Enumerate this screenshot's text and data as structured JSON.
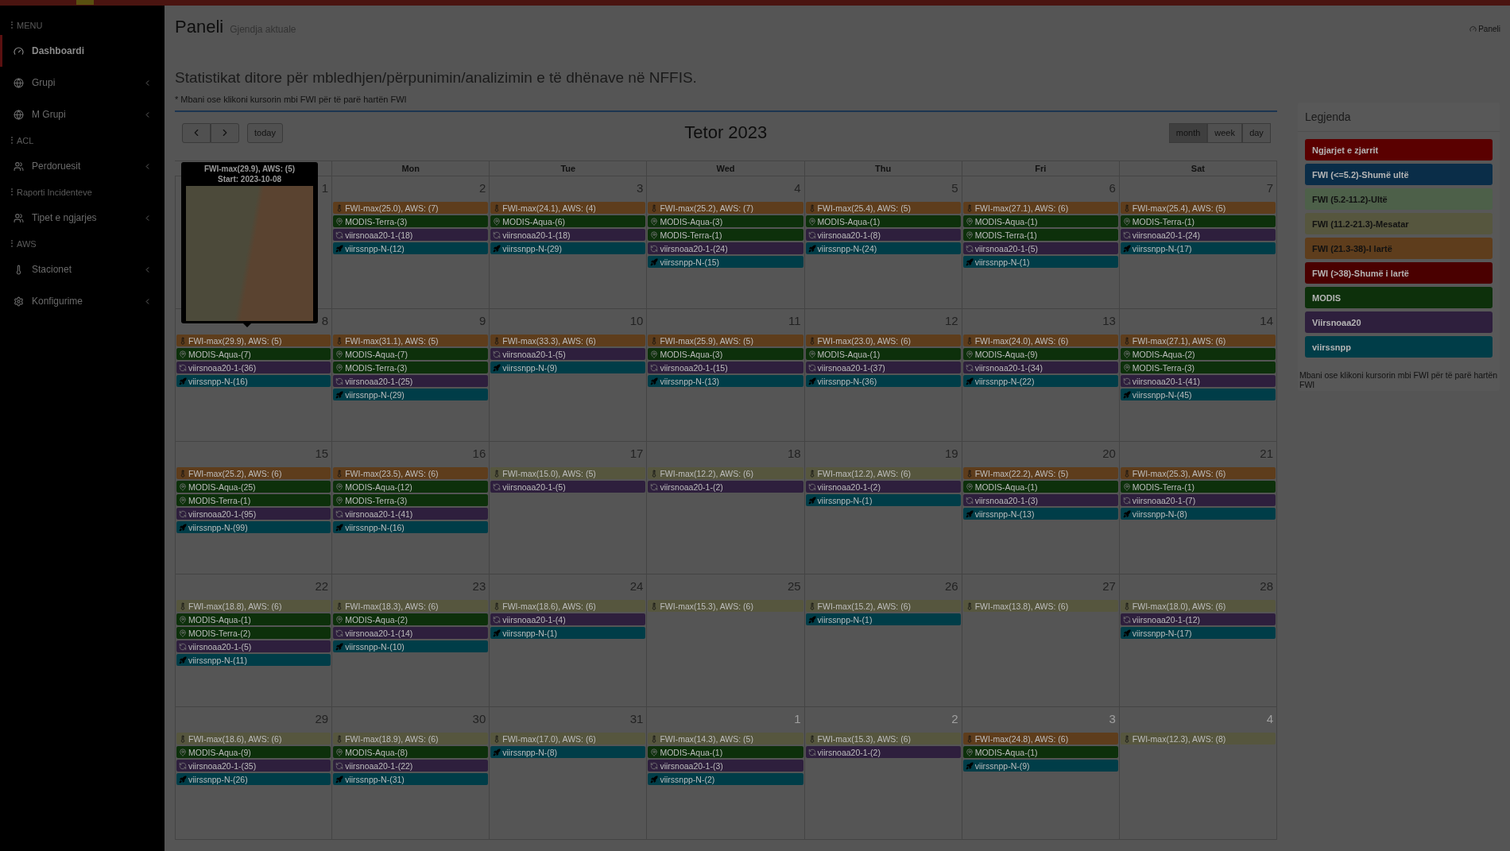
{
  "sidebar": {
    "sections": [
      {
        "header": "MENU",
        "items": [
          {
            "label": "Dashboardi",
            "selected": true,
            "expandable": false
          },
          {
            "label": "Grupi",
            "selected": false,
            "expandable": true
          },
          {
            "label": "M Grupi",
            "selected": false,
            "expandable": true
          }
        ]
      },
      {
        "header": "ACL",
        "items": [
          {
            "label": "Perdoruesit",
            "selected": false,
            "expandable": true
          }
        ]
      },
      {
        "header": "Raporti Incidenteve",
        "items": [
          {
            "label": "Tipet e ngjarjes",
            "selected": false,
            "expandable": true
          }
        ]
      },
      {
        "header": "AWS",
        "items": [
          {
            "label": "Stacionet",
            "selected": false,
            "expandable": true
          },
          {
            "label": "Konfigurime",
            "selected": false,
            "expandable": true
          }
        ]
      }
    ]
  },
  "header": {
    "title": "Paneli",
    "subtitle": "Gjendja aktuale",
    "breadcrumb": "Paneli"
  },
  "intro": {
    "heading": "Statistikat ditore për mbledhjen/përpunimin/analizimin e të dhënave në NFFIS.",
    "note": "* Mbani ose klikoni kursorin mbi FWI për të parë hartën FWI"
  },
  "calendar": {
    "today": "today",
    "title": "Tetor 2023",
    "views": [
      {
        "label": "month",
        "selected": true
      },
      {
        "label": "week",
        "selected": false
      },
      {
        "label": "day",
        "selected": false
      }
    ],
    "weekdays": [
      "Mon",
      "Tue",
      "Wed",
      "Thu",
      "Fri",
      "Sat"
    ],
    "tooltip": {
      "title": "FWI-max(29.9), AWS: (5)",
      "start": "Start: 2023-10-08"
    },
    "weeks": [
      {
        "days": [
          {
            "number": "1",
            "other_month": false
          },
          {
            "number": "2",
            "other_month": false,
            "events": [
              {
                "kind": "fwi",
                "label": "FWI-max(25.0), AWS: (7)",
                "color": "#5e3d1c"
              },
              {
                "kind": "modis",
                "label": "MODIS-Terra-(3)",
                "color": "#0d300b"
              },
              {
                "kind": "noaa",
                "label": "viirsnoaa20-1-(18)",
                "color": "#2e1f3d"
              },
              {
                "kind": "snpp",
                "label": "viirssnpp-N-(12)",
                "color": "#003d48"
              }
            ]
          },
          {
            "number": "3",
            "other_month": false,
            "events": [
              {
                "kind": "fwi",
                "label": "FWI-max(24.1), AWS: (4)",
                "color": "#5e3d1c"
              },
              {
                "kind": "modis",
                "label": "MODIS-Aqua-(6)",
                "color": "#0d300b"
              },
              {
                "kind": "noaa",
                "label": "viirsnoaa20-1-(18)",
                "color": "#2e1f3d"
              },
              {
                "kind": "snpp",
                "label": "viirssnpp-N-(29)",
                "color": "#003d48"
              }
            ]
          },
          {
            "number": "4",
            "other_month": false,
            "events": [
              {
                "kind": "fwi",
                "label": "FWI-max(25.2), AWS: (7)",
                "color": "#5e3d1c"
              },
              {
                "kind": "modis",
                "label": "MODIS-Aqua-(3)",
                "color": "#0d300b"
              },
              {
                "kind": "modis",
                "label": "MODIS-Terra-(1)",
                "color": "#0d300b"
              },
              {
                "kind": "noaa",
                "label": "viirsnoaa20-1-(24)",
                "color": "#2e1f3d"
              },
              {
                "kind": "snpp",
                "label": "viirssnpp-N-(15)",
                "color": "#003d48"
              }
            ]
          },
          {
            "number": "5",
            "other_month": false,
            "events": [
              {
                "kind": "fwi",
                "label": "FWI-max(25.4), AWS: (5)",
                "color": "#5e3d1c"
              },
              {
                "kind": "modis",
                "label": "MODIS-Aqua-(1)",
                "color": "#0d300b"
              },
              {
                "kind": "noaa",
                "label": "viirsnoaa20-1-(8)",
                "color": "#2e1f3d"
              },
              {
                "kind": "snpp",
                "label": "viirssnpp-N-(24)",
                "color": "#003d48"
              }
            ]
          },
          {
            "number": "6",
            "other_month": false,
            "events": [
              {
                "kind": "fwi",
                "label": "FWI-max(27.1), AWS: (6)",
                "color": "#5e3d1c"
              },
              {
                "kind": "modis",
                "label": "MODIS-Aqua-(1)",
                "color": "#0d300b"
              },
              {
                "kind": "modis",
                "label": "MODIS-Terra-(1)",
                "color": "#0d300b"
              },
              {
                "kind": "noaa",
                "label": "viirsnoaa20-1-(5)",
                "color": "#2e1f3d"
              },
              {
                "kind": "snpp",
                "label": "viirssnpp-N-(1)",
                "color": "#003d48"
              }
            ]
          },
          {
            "number": "7",
            "other_month": false,
            "events": [
              {
                "kind": "fwi",
                "label": "FWI-max(25.4), AWS: (5)",
                "color": "#5e3d1c"
              },
              {
                "kind": "modis",
                "label": "MODIS-Terra-(1)",
                "color": "#0d300b"
              },
              {
                "kind": "noaa",
                "label": "viirsnoaa20-1-(24)",
                "color": "#2e1f3d"
              },
              {
                "kind": "snpp",
                "label": "viirssnpp-N-(17)",
                "color": "#003d48"
              }
            ]
          }
        ]
      },
      {
        "days": [
          {
            "number": "8",
            "other_month": false,
            "events": [
              {
                "kind": "fwi",
                "label": "FWI-max(29.9), AWS: (5)",
                "color": "#5e3d1c"
              },
              {
                "kind": "modis",
                "label": "MODIS-Aqua-(7)",
                "color": "#0d300b"
              },
              {
                "kind": "noaa",
                "label": "viirsnoaa20-1-(36)",
                "color": "#2e1f3d"
              },
              {
                "kind": "snpp",
                "label": "viirssnpp-N-(16)",
                "color": "#003d48"
              }
            ]
          },
          {
            "number": "9",
            "other_month": false,
            "events": [
              {
                "kind": "fwi",
                "label": "FWI-max(31.1), AWS: (5)",
                "color": "#5e3d1c"
              },
              {
                "kind": "modis",
                "label": "MODIS-Aqua-(7)",
                "color": "#0d300b"
              },
              {
                "kind": "modis",
                "label": "MODIS-Terra-(3)",
                "color": "#0d300b"
              },
              {
                "kind": "noaa",
                "label": "viirsnoaa20-1-(25)",
                "color": "#2e1f3d"
              },
              {
                "kind": "snpp",
                "label": "viirssnpp-N-(29)",
                "color": "#003d48"
              }
            ]
          },
          {
            "number": "10",
            "other_month": false,
            "events": [
              {
                "kind": "fwi",
                "label": "FWI-max(33.3), AWS: (6)",
                "color": "#5e3d1c"
              },
              {
                "kind": "noaa",
                "label": "viirsnoaa20-1-(5)",
                "color": "#2e1f3d"
              },
              {
                "kind": "snpp",
                "label": "viirssnpp-N-(9)",
                "color": "#003d48"
              }
            ]
          },
          {
            "number": "11",
            "other_month": false,
            "events": [
              {
                "kind": "fwi",
                "label": "FWI-max(25.9), AWS: (5)",
                "color": "#5e3d1c"
              },
              {
                "kind": "modis",
                "label": "MODIS-Aqua-(3)",
                "color": "#0d300b"
              },
              {
                "kind": "noaa",
                "label": "viirsnoaa20-1-(15)",
                "color": "#2e1f3d"
              },
              {
                "kind": "snpp",
                "label": "viirssnpp-N-(13)",
                "color": "#003d48"
              }
            ]
          },
          {
            "number": "12",
            "other_month": false,
            "events": [
              {
                "kind": "fwi",
                "label": "FWI-max(23.0), AWS: (6)",
                "color": "#5e3d1c"
              },
              {
                "kind": "modis",
                "label": "MODIS-Aqua-(1)",
                "color": "#0d300b"
              },
              {
                "kind": "noaa",
                "label": "viirsnoaa20-1-(37)",
                "color": "#2e1f3d"
              },
              {
                "kind": "snpp",
                "label": "viirssnpp-N-(36)",
                "color": "#003d48"
              }
            ]
          },
          {
            "number": "13",
            "other_month": false,
            "events": [
              {
                "kind": "fwi",
                "label": "FWI-max(24.0), AWS: (6)",
                "color": "#5e3d1c"
              },
              {
                "kind": "modis",
                "label": "MODIS-Aqua-(9)",
                "color": "#0d300b"
              },
              {
                "kind": "noaa",
                "label": "viirsnoaa20-1-(34)",
                "color": "#2e1f3d"
              },
              {
                "kind": "snpp",
                "label": "viirssnpp-N-(22)",
                "color": "#003d48"
              }
            ]
          },
          {
            "number": "14",
            "other_month": false,
            "events": [
              {
                "kind": "fwi",
                "label": "FWI-max(27.1), AWS: (6)",
                "color": "#5e3d1c"
              },
              {
                "kind": "modis",
                "label": "MODIS-Aqua-(2)",
                "color": "#0d300b"
              },
              {
                "kind": "modis",
                "label": "MODIS-Terra-(3)",
                "color": "#0d300b"
              },
              {
                "kind": "noaa",
                "label": "viirsnoaa20-1-(41)",
                "color": "#2e1f3d"
              },
              {
                "kind": "snpp",
                "label": "viirssnpp-N-(45)",
                "color": "#003d48"
              }
            ]
          }
        ]
      },
      {
        "days": [
          {
            "number": "15",
            "other_month": false,
            "events": [
              {
                "kind": "fwi",
                "label": "FWI-max(25.2), AWS: (6)",
                "color": "#5e3d1c"
              },
              {
                "kind": "modis",
                "label": "MODIS-Aqua-(25)",
                "color": "#0d300b"
              },
              {
                "kind": "modis",
                "label": "MODIS-Terra-(1)",
                "color": "#0d300b"
              },
              {
                "kind": "noaa",
                "label": "viirsnoaa20-1-(95)",
                "color": "#2e1f3d"
              },
              {
                "kind": "snpp",
                "label": "viirssnpp-N-(99)",
                "color": "#003d48"
              }
            ]
          },
          {
            "number": "16",
            "other_month": false,
            "events": [
              {
                "kind": "fwi",
                "label": "FWI-max(23.5), AWS: (6)",
                "color": "#5e3d1c"
              },
              {
                "kind": "modis",
                "label": "MODIS-Aqua-(12)",
                "color": "#0d300b"
              },
              {
                "kind": "modis",
                "label": "MODIS-Terra-(3)",
                "color": "#0d300b"
              },
              {
                "kind": "noaa",
                "label": "viirsnoaa20-1-(41)",
                "color": "#2e1f3d"
              },
              {
                "kind": "snpp",
                "label": "viirssnpp-N-(16)",
                "color": "#003d48"
              }
            ]
          },
          {
            "number": "17",
            "other_month": false,
            "events": [
              {
                "kind": "fwi",
                "label": "FWI-max(15.0), AWS: (5)",
                "color": "#56563e"
              },
              {
                "kind": "noaa",
                "label": "viirsnoaa20-1-(5)",
                "color": "#2e1f3d"
              }
            ]
          },
          {
            "number": "18",
            "other_month": false,
            "events": [
              {
                "kind": "fwi",
                "label": "FWI-max(12.2), AWS: (6)",
                "color": "#56563e"
              },
              {
                "kind": "noaa",
                "label": "viirsnoaa20-1-(2)",
                "color": "#2e1f3d"
              }
            ]
          },
          {
            "number": "19",
            "other_month": false,
            "events": [
              {
                "kind": "fwi",
                "label": "FWI-max(12.2), AWS: (6)",
                "color": "#56563e"
              },
              {
                "kind": "noaa",
                "label": "viirsnoaa20-1-(2)",
                "color": "#2e1f3d"
              },
              {
                "kind": "snpp",
                "label": "viirssnpp-N-(1)",
                "color": "#003d48"
              }
            ]
          },
          {
            "number": "20",
            "other_month": false,
            "events": [
              {
                "kind": "fwi",
                "label": "FWI-max(22.2), AWS: (5)",
                "color": "#5e3d1c"
              },
              {
                "kind": "modis",
                "label": "MODIS-Aqua-(1)",
                "color": "#0d300b"
              },
              {
                "kind": "noaa",
                "label": "viirsnoaa20-1-(3)",
                "color": "#2e1f3d"
              },
              {
                "kind": "snpp",
                "label": "viirssnpp-N-(13)",
                "color": "#003d48"
              }
            ]
          },
          {
            "number": "21",
            "other_month": false,
            "events": [
              {
                "kind": "fwi",
                "label": "FWI-max(25.3), AWS: (6)",
                "color": "#5e3d1c"
              },
              {
                "kind": "modis",
                "label": "MODIS-Terra-(1)",
                "color": "#0d300b"
              },
              {
                "kind": "noaa",
                "label": "viirsnoaa20-1-(7)",
                "color": "#2e1f3d"
              },
              {
                "kind": "snpp",
                "label": "viirssnpp-N-(8)",
                "color": "#003d48"
              }
            ]
          }
        ]
      },
      {
        "days": [
          {
            "number": "22",
            "other_month": false,
            "events": [
              {
                "kind": "fwi",
                "label": "FWI-max(18.8), AWS: (6)",
                "color": "#56563e"
              },
              {
                "kind": "modis",
                "label": "MODIS-Aqua-(1)",
                "color": "#0d300b"
              },
              {
                "kind": "modis",
                "label": "MODIS-Terra-(2)",
                "color": "#0d300b"
              },
              {
                "kind": "noaa",
                "label": "viirsnoaa20-1-(5)",
                "color": "#2e1f3d"
              },
              {
                "kind": "snpp",
                "label": "viirssnpp-N-(11)",
                "color": "#003d48"
              }
            ]
          },
          {
            "number": "23",
            "other_month": false,
            "events": [
              {
                "kind": "fwi",
                "label": "FWI-max(18.3), AWS: (6)",
                "color": "#56563e"
              },
              {
                "kind": "modis",
                "label": "MODIS-Aqua-(2)",
                "color": "#0d300b"
              },
              {
                "kind": "noaa",
                "label": "viirsnoaa20-1-(14)",
                "color": "#2e1f3d"
              },
              {
                "kind": "snpp",
                "label": "viirssnpp-N-(10)",
                "color": "#003d48"
              }
            ]
          },
          {
            "number": "24",
            "other_month": false,
            "events": [
              {
                "kind": "fwi",
                "label": "FWI-max(18.6), AWS: (6)",
                "color": "#56563e"
              },
              {
                "kind": "noaa",
                "label": "viirsnoaa20-1-(4)",
                "color": "#2e1f3d"
              },
              {
                "kind": "snpp",
                "label": "viirssnpp-N-(1)",
                "color": "#003d48"
              }
            ]
          },
          {
            "number": "25",
            "other_month": false,
            "events": [
              {
                "kind": "fwi",
                "label": "FWI-max(15.3), AWS: (6)",
                "color": "#56563e"
              }
            ]
          },
          {
            "number": "26",
            "other_month": false,
            "events": [
              {
                "kind": "fwi",
                "label": "FWI-max(15.2), AWS: (6)",
                "color": "#56563e"
              },
              {
                "kind": "snpp",
                "label": "viirssnpp-N-(1)",
                "color": "#003d48"
              }
            ]
          },
          {
            "number": "27",
            "other_month": false,
            "events": [
              {
                "kind": "fwi",
                "label": "FWI-max(13.8), AWS: (6)",
                "color": "#56563e"
              }
            ]
          },
          {
            "number": "28",
            "other_month": false,
            "events": [
              {
                "kind": "fwi",
                "label": "FWI-max(18.0), AWS: (6)",
                "color": "#56563e"
              },
              {
                "kind": "noaa",
                "label": "viirsnoaa20-1-(12)",
                "color": "#2e1f3d"
              },
              {
                "kind": "snpp",
                "label": "viirssnpp-N-(17)",
                "color": "#003d48"
              }
            ]
          }
        ]
      },
      {
        "days": [
          {
            "number": "29",
            "other_month": false,
            "events": [
              {
                "kind": "fwi",
                "label": "FWI-max(18.6), AWS: (6)",
                "color": "#56563e"
              },
              {
                "kind": "modis",
                "label": "MODIS-Aqua-(9)",
                "color": "#0d300b"
              },
              {
                "kind": "noaa",
                "label": "viirsnoaa20-1-(35)",
                "color": "#2e1f3d"
              },
              {
                "kind": "snpp",
                "label": "viirssnpp-N-(26)",
                "color": "#003d48"
              }
            ]
          },
          {
            "number": "30",
            "other_month": false,
            "events": [
              {
                "kind": "fwi",
                "label": "FWI-max(18.9), AWS: (6)",
                "color": "#56563e"
              },
              {
                "kind": "modis",
                "label": "MODIS-Aqua-(8)",
                "color": "#0d300b"
              },
              {
                "kind": "noaa",
                "label": "viirsnoaa20-1-(22)",
                "color": "#2e1f3d"
              },
              {
                "kind": "snpp",
                "label": "viirssnpp-N-(31)",
                "color": "#003d48"
              }
            ]
          },
          {
            "number": "31",
            "other_month": false,
            "events": [
              {
                "kind": "fwi",
                "label": "FWI-max(17.0), AWS: (6)",
                "color": "#56563e"
              },
              {
                "kind": "snpp",
                "label": "viirssnpp-N-(8)",
                "color": "#003d48"
              }
            ]
          },
          {
            "number": "1",
            "other_month": true,
            "events": [
              {
                "kind": "fwi",
                "label": "FWI-max(14.3), AWS: (5)",
                "color": "#56563e"
              },
              {
                "kind": "modis",
                "label": "MODIS-Aqua-(1)",
                "color": "#0d300b"
              },
              {
                "kind": "noaa",
                "label": "viirsnoaa20-1-(3)",
                "color": "#2e1f3d"
              },
              {
                "kind": "snpp",
                "label": "viirssnpp-N-(2)",
                "color": "#003d48"
              }
            ]
          },
          {
            "number": "2",
            "other_month": true,
            "events": [
              {
                "kind": "fwi",
                "label": "FWI-max(15.3), AWS: (6)",
                "color": "#56563e"
              },
              {
                "kind": "noaa",
                "label": "viirsnoaa20-1-(2)",
                "color": "#2e1f3d"
              }
            ]
          },
          {
            "number": "3",
            "other_month": true,
            "events": [
              {
                "kind": "fwi",
                "label": "FWI-max(24.8), AWS: (6)",
                "color": "#5e3d1c"
              },
              {
                "kind": "modis",
                "label": "MODIS-Aqua-(1)",
                "color": "#0d300b"
              },
              {
                "kind": "snpp",
                "label": "viirssnpp-N-(9)",
                "color": "#003d48"
              }
            ]
          },
          {
            "number": "4",
            "other_month": true,
            "events": [
              {
                "kind": "fwi",
                "label": "FWI-max(12.3), AWS: (8)",
                "color": "#56563e"
              }
            ]
          }
        ]
      }
    ]
  },
  "legend": {
    "title": "Legjenda",
    "items": [
      {
        "label": "Ngjarjet e zjarrit",
        "color": "#5a0000"
      },
      {
        "label": "FWI (<=5.2)-Shumë ultë",
        "color": "#0a2d48"
      },
      {
        "label": "FWI (5.2-11.2)-Ultë",
        "color": "#4d6049"
      },
      {
        "label": "FWI (11.2-21.3)-Mesatar",
        "color": "#56563e"
      },
      {
        "label": "FWI (21.3-38)-I lartë",
        "color": "#5e3d1c"
      },
      {
        "label": "FWI (>38)-Shumë i lartë",
        "color": "#4a0000"
      },
      {
        "label": "MODIS",
        "color": "#0d300b"
      },
      {
        "label": "Viirsnoaa20",
        "color": "#2e1f3d"
      },
      {
        "label": "viirssnpp",
        "color": "#003d48"
      }
    ],
    "note": "Mbani ose klikoni kursorin mbi FWI për të parë hartën FWI"
  }
}
